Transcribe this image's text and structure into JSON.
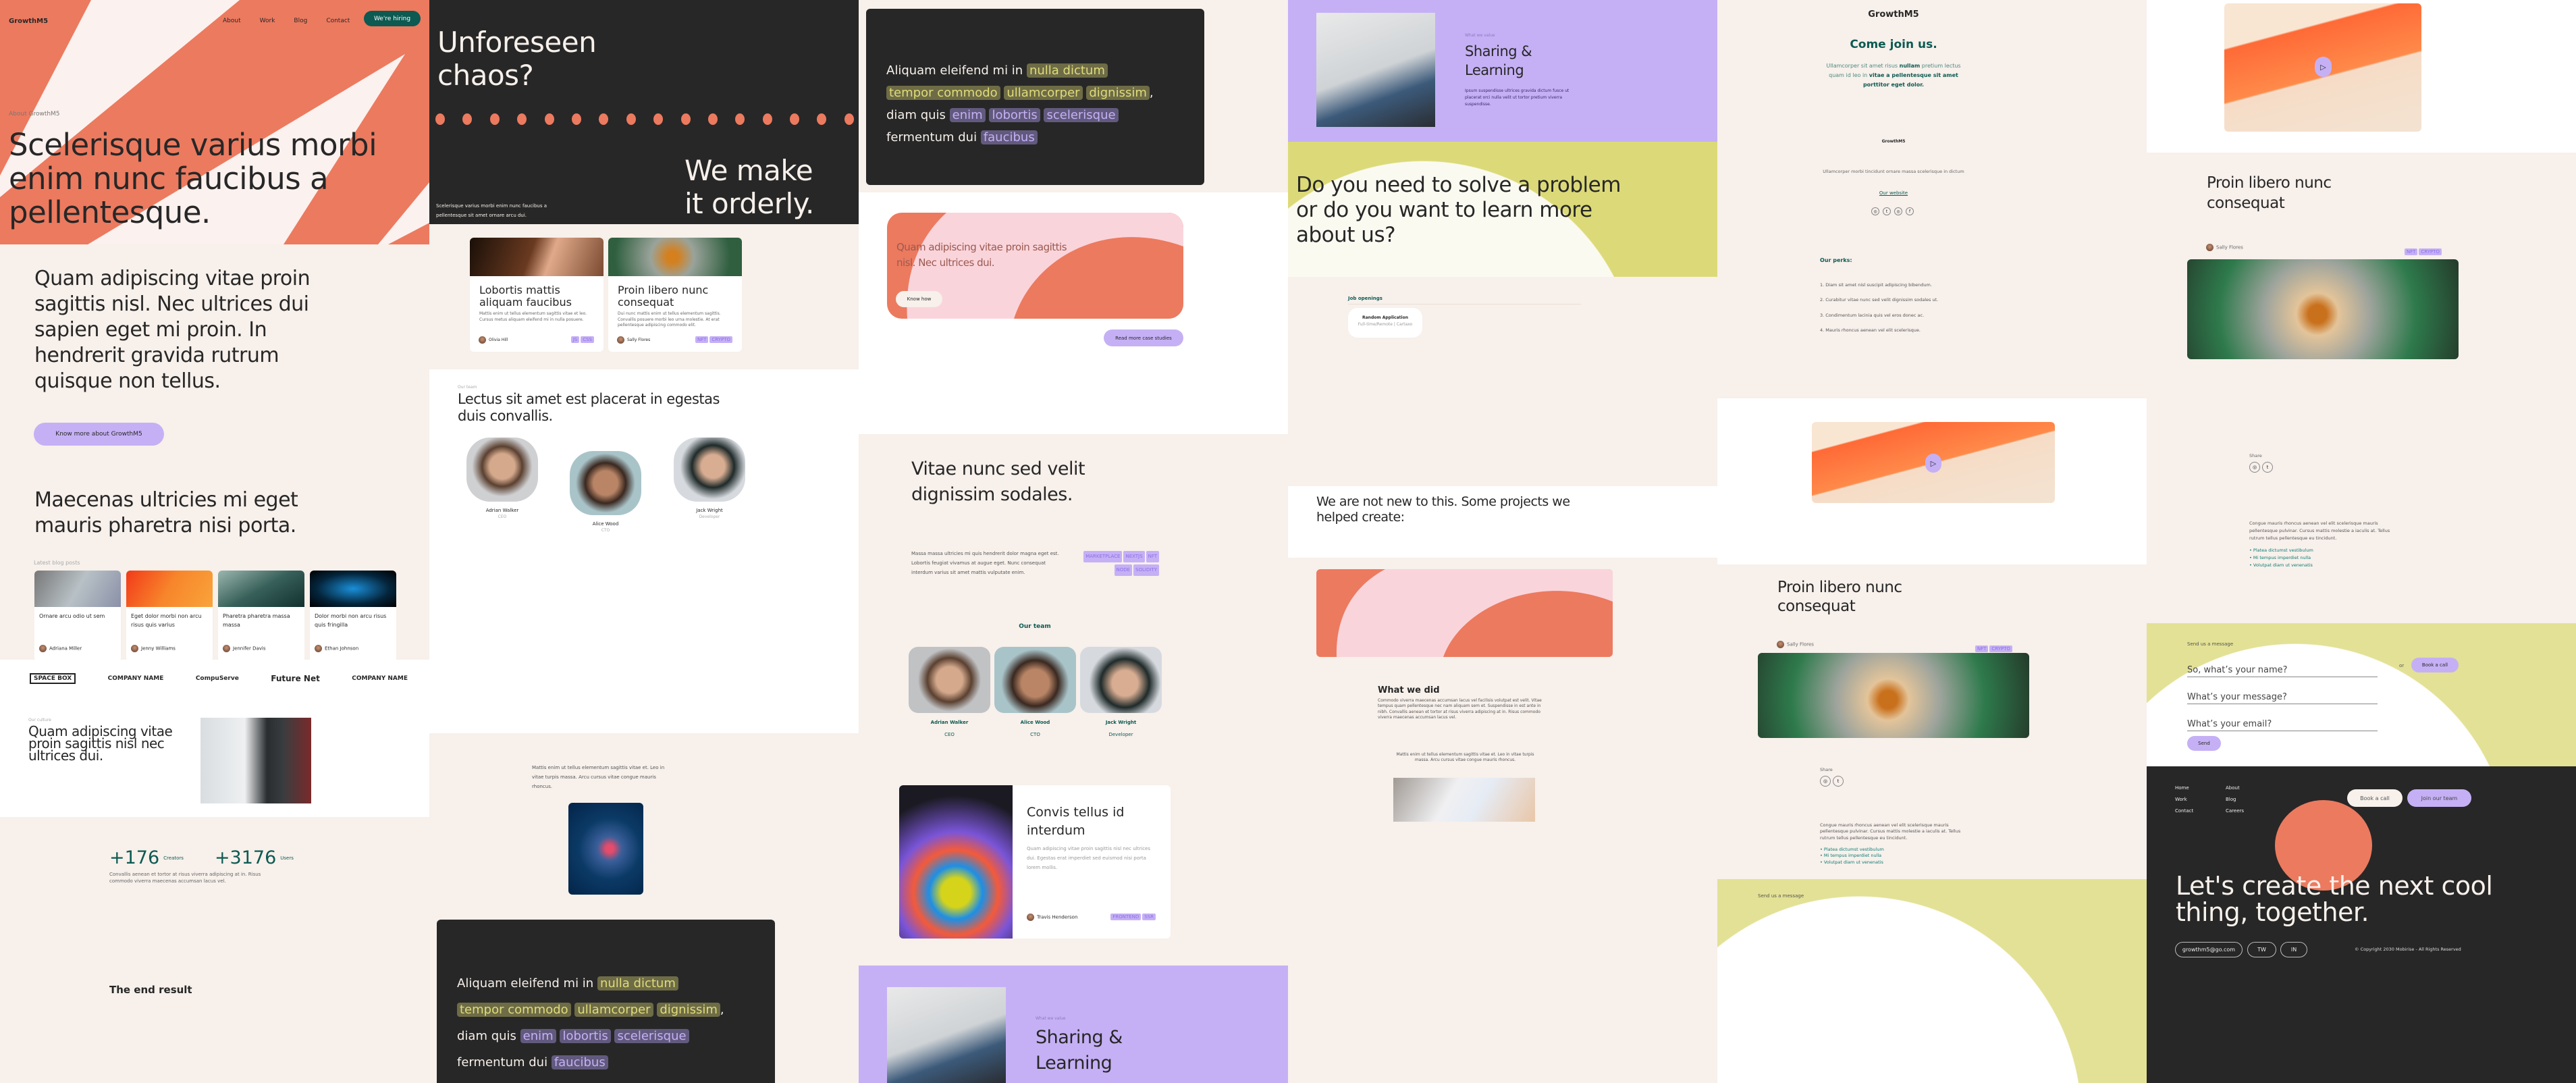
{
  "colors": {
    "coral": "#ec7a5f",
    "cream": "#f7f0eb",
    "dark": "#272727",
    "lavender": "#c5b0f5",
    "teal": "#0c5a52",
    "lime": "#dcda78",
    "pink": "#fad4db"
  },
  "col1": {
    "nav": {
      "logo": "GrowthM5",
      "links": [
        "About",
        "Work",
        "Blog",
        "Contact"
      ],
      "cta": "We're hiring"
    },
    "hero": {
      "eyebrow": "About GrowthM5",
      "title": "Scelerisque varius morbi enim nunc faucibus a pellentesque."
    },
    "intro": {
      "text": "Quam adipiscing vitae proin sagittis nisl. Nec ultrices dui sapien eget mi proin. In hendrerit gravida rutrum quisque non tellus.",
      "button": "Know more about GrowthM5"
    },
    "blog": {
      "heading": "Maecenas ultricies mi eget mauris pharetra nisi porta.",
      "label": "Latest blog posts",
      "posts": [
        {
          "title": "Ornare arcu odio ut sem",
          "author": "Adriana Miller"
        },
        {
          "title": "Eget dolor morbi non arcu risus quis varius",
          "author": "Jenny Williams"
        },
        {
          "title": "Pharetra pharetra massa massa",
          "author": "Jennifer Davis"
        },
        {
          "title": "Dolor morbi non arcu risus quis fringilla",
          "author": "Ethan Johnson"
        }
      ]
    },
    "logos": [
      "SPACE BOX",
      "COMPANY NAME",
      "CompuServe",
      "Future Net",
      "COMPANY NAME"
    ],
    "culture": {
      "label": "Our culture",
      "text": "Quam adipiscing vitae proin sagittis nisl nec ultrices dui."
    },
    "result": {
      "title": "The end result",
      "stat1": "+176",
      "stat1_label": "Creators",
      "stat2": "+3176",
      "stat2_label": "Users",
      "text": "Convallis aenean et tortor at risus viverra adipiscing at in. Risus commodo viverra maecenas accumsan lacus vel."
    }
  },
  "col2": {
    "chaos": {
      "title": "Unforeseen chaos?",
      "text": "Scelerisque varius morbi enim nunc faucibus a pellentesque sit amet ornare arcu dui.",
      "title2": "We make it orderly."
    },
    "cards": [
      {
        "title": "Lobortis mattis aliquam faucibus",
        "text": "Mattis enim ut tellus elementum sagittis vitae et leo. Cursus metus aliquam eleifend mi in nulla posuere.",
        "author": "Olivia Hill",
        "tags": [
          "JS",
          "CSS"
        ]
      },
      {
        "title": "Proin libero nunc consequat",
        "text": "Dui nunc mattis enim ut tellus elementum sagittis. Convallis posuere morbi leo urna molestie. At erat pellentesque adipiscing commodo elit.",
        "author": "Sally Flores",
        "tags": [
          "NFT",
          "CRYPTO"
        ]
      }
    ],
    "team": {
      "label": "Our team",
      "title": "Lectus sit amet est placerat in egestas duis convallis.",
      "members": [
        {
          "name": "Adrian Walker",
          "role": "CEO"
        },
        {
          "name": "Alice Wood",
          "role": "CTO"
        },
        {
          "name": "Jack Wright",
          "role": "Developer"
        }
      ]
    },
    "cube": {
      "text": "Mattis enim ut tellus elementum sagittis vitae et. Leo in vitae turpis massa. Arcu cursus vitae congue mauris rhoncus."
    },
    "quote": {
      "a": "Aliquam eleifend mi in",
      "h1": [
        "nulla dictum",
        "tempor commodo",
        "ullamcorper",
        "dignissim"
      ],
      "b": "diam quis",
      "h2": [
        "enim",
        "lobortis",
        "scelerisque"
      ],
      "c": "fermentum dui",
      "h3": "faucibus"
    }
  },
  "col3": {
    "quote": {
      "a": "Aliquam eleifend mi in",
      "h1": [
        "nulla dictum",
        "tempor commodo",
        "ullamcorper",
        "dignissim"
      ],
      "b": "diam quis",
      "h2": [
        "enim",
        "lobortis",
        "scelerisque"
      ],
      "c": "fermentum dui",
      "h3": "faucibus"
    },
    "case": {
      "text": "Quam adipiscing vitae proin sagittis nisl. Nec ultrices dui.",
      "button": "Know how",
      "more": "Read more case studies"
    },
    "project": {
      "title": "Vitae nunc sed velit dignissim sodales.",
      "text": "Massa massa ultricies mi quis hendrerit dolor magna eget est. Lobortis feugiat vivamus at augue eget. Nunc consequat interdum varius sit amet mattis vulputate enim.",
      "tags": [
        "MARKETPLACE",
        "NEXTJS",
        "NFT",
        "NODE",
        "SOLIDITY"
      ]
    },
    "team": {
      "label": "Our team",
      "members": [
        {
          "name": "Adrian Walker",
          "role": "CEO"
        },
        {
          "name": "Alice Wood",
          "role": "CTO"
        },
        {
          "name": "Jack Wright",
          "role": "Developer"
        }
      ]
    },
    "post": {
      "title": "Convis tellus id interdum",
      "text": "Quam adipiscing vitae proin sagittis nisl nec ultrices dui. Egestas erat imperdiet sed euismod nisi porta lorem mollis.",
      "author": "Travis Henderson",
      "tags": [
        "FRONTEND",
        "SSR"
      ]
    },
    "value": {
      "label": "What we value",
      "title": "Sharing & Learning"
    }
  },
  "col4": {
    "value": {
      "label": "What we value",
      "title": "Sharing & Learning",
      "text": "Ipsum suspendisse ultrices gravida dictum fusce ut placerat orci nulla velit ut tortor pretium viverra suspendisse."
    },
    "cta": {
      "title": "Do you need to solve a problem or do you want to learn more about us?"
    },
    "jobs": {
      "label": "Job openings",
      "job_title": "Random Application",
      "job_meta": "Full-time/Remote | Cartaxo"
    },
    "projects": {
      "title": "We are not new to this. Some projects we helped create:"
    },
    "did": {
      "title": "What we did",
      "text": "Commodo viverra maecenas accumsan lacus vel facilisis volutpat est velit. Vitae tempus quam pellentesque nec nam aliquam sem et. Suspendisse in est ante in nibh. Convallis aenean et tortor at risus viverra adipiscing at in. Risus commodo viverra maecenas accumsan lacus vel.",
      "caption": "Mattis enim ut tellus elementum sagittis vitae et. Leo in vitae turpis massa. Arcu cursus vitae congue mauris rhoncus."
    }
  },
  "col5": {
    "logo": "GrowthM5",
    "title": "Come join us.",
    "intro_a": "Ullamcorper sit amet risus ",
    "intro_b": "nullam",
    "intro_c": " pretium lectus quam id leo in ",
    "intro_d": "vitae a pellentesque sit amet porttitor eget dolor.",
    "logo_small": "GrowthM5",
    "desc": "Ullamcorper morbi tincidunt ornare massa scelerisque in dictum",
    "link": "Our website",
    "social": [
      "instagram-icon",
      "twitter-icon",
      "instagram-icon",
      "facebook-icon"
    ],
    "perks_title": "Our perks:",
    "perks": [
      "1. Diam sit amet nisl suscipit adipiscing bibendum.",
      "2. Curabitur vitae nunc sed velit dignissim sodales ut.",
      "3. Condimentum lacinia quis vel eros donec ac.",
      "4. Mauris rhoncus aenean vel elit scelerisque."
    ],
    "article": {
      "title": "Proin libero nunc consequat",
      "author": "Sally Flores",
      "tags": [
        "NFT",
        "CRYPTO"
      ],
      "share": "Share",
      "text": "Congue mauris rhoncus aenean vel elit scelerisque mauris pellentesque pulvinar. Cursus mattis molestie a iaculis at. Tellus rutrum tellus pellentesque eu tincidunt.",
      "bullets": [
        "Platea dictumst vestibulum",
        "Mi tempus imperdiet nulla",
        "Volutpat diam ut venenatis"
      ]
    },
    "message_label": "Send us a message"
  },
  "col6": {
    "article": {
      "title": "Proin libero nunc consequat",
      "author": "Sally Flores",
      "tags": [
        "NFT",
        "CRYPTO"
      ],
      "share": "Share",
      "text": "Congue mauris rhoncus aenean vel elit scelerisque mauris pellentesque pulvinar. Cursus mattis molestie a iaculis at. Tellus rutrum tellus pellentesque eu tincidunt.",
      "bullets": [
        "Platea dictumst vestibulum",
        "Mi tempus imperdiet nulla",
        "Volutpat diam ut venenatis"
      ]
    },
    "form": {
      "label": "Send us a message",
      "name": "So, what’s your name?",
      "message": "What’s your message?",
      "email": "What’s your email?",
      "send": "Send",
      "or": "or",
      "book": "Book a call"
    },
    "footer": {
      "links": [
        "Home",
        "Work",
        "Contact",
        "About",
        "Blog",
        "Careers"
      ],
      "book": "Book a call",
      "join": "Join our team",
      "title": "Let's create the next cool thing, together.",
      "email": "growthm5@go.com",
      "tw": "TW",
      "in": "IN",
      "copyright": "© Copyright 2030 Mobirise - All Rights Reserved"
    }
  }
}
